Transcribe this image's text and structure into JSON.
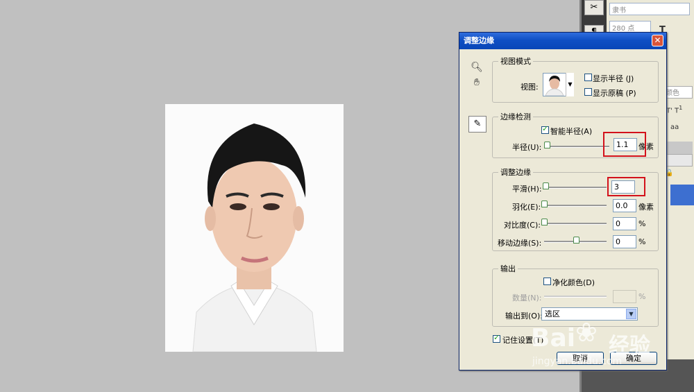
{
  "dialog": {
    "title": "调整边缘",
    "close_glyph": "✕",
    "view_mode": {
      "legend": "视图模式",
      "view_label": "视图:",
      "show_radius": "显示半径 (J)",
      "show_original": "显示原稿 (P)"
    },
    "edge_detection": {
      "legend": "边缘检测",
      "smart_radius": "智能半径(A)",
      "radius_label": "半径(U):",
      "radius_value": "1.1",
      "radius_unit": "像素"
    },
    "adjust_edge": {
      "legend": "调整边缘",
      "smooth_label": "平滑(H):",
      "smooth_value": "3",
      "feather_label": "羽化(E):",
      "feather_value": "0.0",
      "feather_unit": "像素",
      "contrast_label": "对比度(C):",
      "contrast_value": "0",
      "contrast_unit": "%",
      "shift_label": "移动边缘(S):",
      "shift_value": "0",
      "shift_unit": "%"
    },
    "output": {
      "legend": "输出",
      "decontaminate": "净化颜色(D)",
      "amount_label": "数量(N):",
      "amount_unit": "%",
      "output_to_label": "输出到(O):",
      "output_to_value": "选区"
    },
    "remember_settings": "记住设置(T)",
    "cancel": "取消",
    "ok": "确定"
  },
  "options_panel": {
    "font_name": "隶书",
    "font_size": "280 点",
    "color_label": "颜色"
  },
  "watermark": {
    "brand": "Bai",
    "brand2": "经验",
    "url": "jingyan.baidu.com"
  },
  "colors": {
    "accent": "#0846b8",
    "highlight": "#d3111b"
  }
}
